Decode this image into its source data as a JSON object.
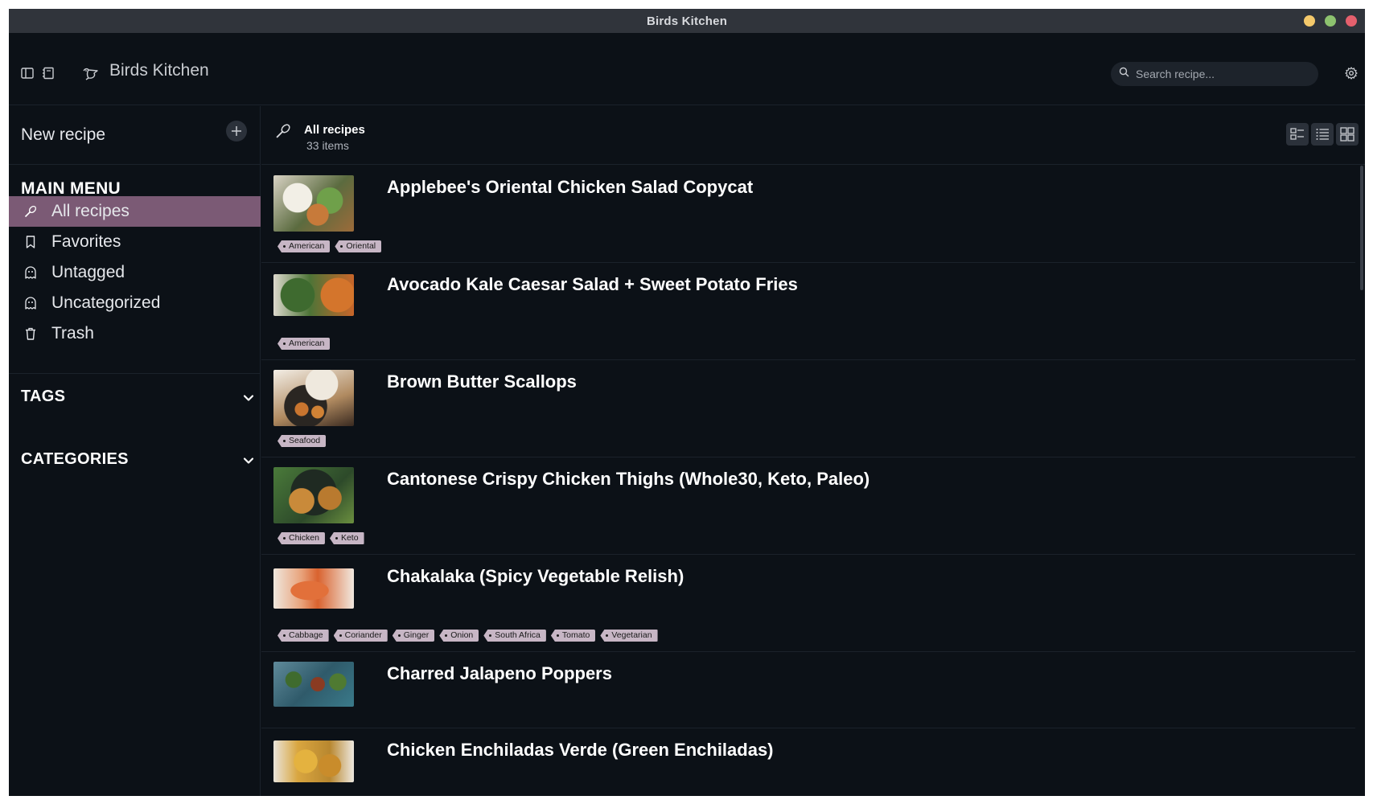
{
  "window": {
    "title": "Birds Kitchen",
    "buttons": [
      {
        "name": "minimize",
        "color": "#f4c96b"
      },
      {
        "name": "maximize",
        "color": "#8dc26f"
      },
      {
        "name": "close",
        "color": "#e5606d"
      }
    ]
  },
  "header": {
    "app_name": "Birds Kitchen",
    "search_placeholder": "Search recipe...",
    "icons": [
      "sidebar-toggle-icon",
      "notebook-icon",
      "bird-icon",
      "search-icon",
      "gear-icon"
    ]
  },
  "sidebar": {
    "new_recipe_label": "New recipe",
    "main_menu_heading": "MAIN MENU",
    "items": [
      {
        "label": "All recipes",
        "icon": "whisk-icon",
        "active": true
      },
      {
        "label": "Favorites",
        "icon": "bookmark-icon",
        "active": false
      },
      {
        "label": "Untagged",
        "icon": "ghost-icon",
        "active": false
      },
      {
        "label": "Uncategorized",
        "icon": "ghost-icon",
        "active": false
      },
      {
        "label": "Trash",
        "icon": "trash-icon",
        "active": false
      }
    ],
    "tags_heading": "TAGS",
    "categories_heading": "CATEGORIES",
    "accent": "#7b5a75"
  },
  "content": {
    "title": "All recipes",
    "count": "33 items",
    "view_modes": [
      "list-detail-view",
      "list-view",
      "grid-view"
    ]
  },
  "recipes": [
    {
      "title": "Applebee's Oriental Chicken Salad Copycat",
      "tags": [
        "American",
        "Oriental"
      ]
    },
    {
      "title": "Avocado Kale Caesar Salad + Sweet Potato Fries",
      "tags": [
        "American"
      ]
    },
    {
      "title": "Brown Butter Scallops",
      "tags": [
        "Seafood"
      ]
    },
    {
      "title": "Cantonese Crispy Chicken Thighs (Whole30, Keto, Paleo)",
      "tags": [
        "Chicken",
        "Keto"
      ]
    },
    {
      "title": "Chakalaka (Spicy Vegetable Relish)",
      "tags": [
        "Cabbage",
        "Coriander",
        "Ginger",
        "Onion",
        "South Africa",
        "Tomato",
        "Vegetarian"
      ]
    },
    {
      "title": "Charred Jalapeno Poppers",
      "tags": []
    },
    {
      "title": "Chicken Enchiladas Verde (Green Enchiladas)",
      "tags": []
    }
  ]
}
